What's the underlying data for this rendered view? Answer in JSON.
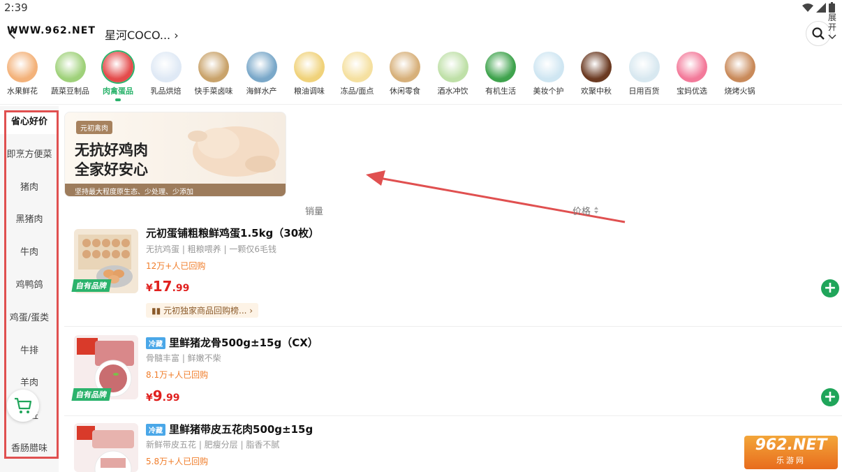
{
  "status": {
    "time": "2:39"
  },
  "header": {
    "watermark_text": "WWW.962.NET",
    "store_name": "星河COCO...",
    "store_chevron": "›"
  },
  "categories": [
    {
      "label": "水果鲜花",
      "color": "#f3b27a"
    },
    {
      "label": "蔬菜豆制品",
      "color": "#9fd17a"
    },
    {
      "label": "肉禽蛋品",
      "color": "#e44b4b",
      "active": true
    },
    {
      "label": "乳品烘焙",
      "color": "#dfe9f5"
    },
    {
      "label": "快手菜卤味",
      "color": "#c9a36b"
    },
    {
      "label": "海鲜水产",
      "color": "#7aa8c9"
    },
    {
      "label": "粮油调味",
      "color": "#f0d27a"
    },
    {
      "label": "冻品/面点",
      "color": "#f5e0a0"
    },
    {
      "label": "休闲零食",
      "color": "#d7b07a"
    },
    {
      "label": "酒水冲饮",
      "color": "#bfe0a8"
    },
    {
      "label": "有机生活",
      "color": "#3fa34d"
    },
    {
      "label": "美妆个护",
      "color": "#cfe6f2"
    },
    {
      "label": "欢聚中秋",
      "color": "#6b3a22"
    },
    {
      "label": "日用百货",
      "color": "#d8e8f0"
    },
    {
      "label": "宝妈优选",
      "color": "#f37a9a"
    },
    {
      "label": "烧烤火锅",
      "color": "#c98a5a"
    }
  ],
  "expand_label_1": "展",
  "expand_label_2": "开",
  "sidebar": {
    "items": [
      "省心好价",
      "即烹方便菜",
      "猪肉",
      "黑猪肉",
      "牛肉",
      "鸡鸭鸽",
      "鸡蛋/蛋类",
      "牛排",
      "羊肉",
      "内脏",
      "香肠腊味"
    ]
  },
  "banner": {
    "tag": "元初禽肉",
    "title_line1": "无抗好鸡肉",
    "title_line2": "全家好安心",
    "footer": "坚持最大程度原生态、少处理、少添加"
  },
  "sort": {
    "sales": "销量",
    "price": "价格"
  },
  "products": [
    {
      "title": "元初蛋铺粗粮鲜鸡蛋1.5kg（30枚）",
      "subtitle": "无抗鸡蛋 | 粗粮喂养 | 一颗仅6毛钱",
      "sold": "12万+人已回购",
      "price_currency": "¥",
      "price_int": "17",
      "price_dec": ".99",
      "badge": "自有品牌",
      "rank": "元初独家商品回购榜... ›"
    },
    {
      "tag": "冷藏",
      "title": "里鲜猪龙骨500g±15g（CX）",
      "subtitle": "骨髓丰富 | 鲜嫩不柴",
      "sold": "8.1万+人已回购",
      "price_currency": "¥",
      "price_int": "9",
      "price_dec": ".99",
      "badge": "自有品牌"
    },
    {
      "tag": "冷藏",
      "title": "里鲜猪带皮五花肉500g±15g",
      "subtitle": "新鲜带皮五花 | 肥瘦分层 | 脂香不腻",
      "sold": "5.8万+人已回购"
    }
  ],
  "corner_logo": {
    "big": "962.NET",
    "small": "乐游网"
  },
  "colors": {
    "accent": "#2bb36c",
    "price": "#e0201e",
    "highlight_outline": "#e05050"
  }
}
